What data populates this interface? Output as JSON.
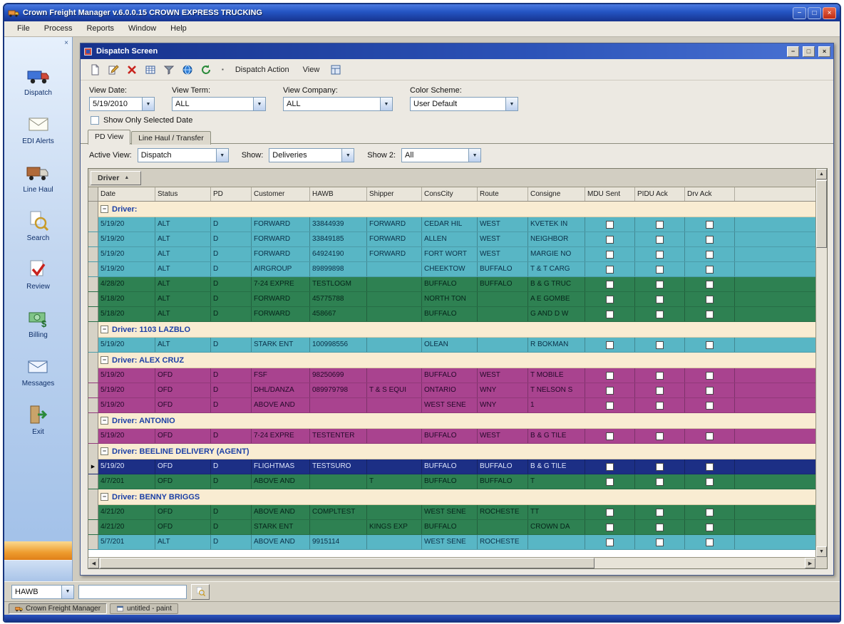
{
  "app": {
    "title": "Crown Freight Manager v.6.0.0.15 CROWN EXPRESS TRUCKING",
    "menu": [
      "File",
      "Process",
      "Reports",
      "Window",
      "Help"
    ]
  },
  "sidebar": {
    "items": [
      {
        "label": "Dispatch",
        "icon": "dispatch-truck-icon"
      },
      {
        "label": "EDI Alerts",
        "icon": "edi-alerts-mail-icon"
      },
      {
        "label": "Line Haul",
        "icon": "line-haul-truck-icon"
      },
      {
        "label": "Search",
        "icon": "search-icon"
      },
      {
        "label": "Review",
        "icon": "review-check-icon"
      },
      {
        "label": "Billing",
        "icon": "billing-money-icon"
      },
      {
        "label": "Messages",
        "icon": "messages-mail-icon"
      },
      {
        "label": "Exit",
        "icon": "exit-icon"
      }
    ]
  },
  "dispatch": {
    "title": "Dispatch Screen",
    "toolbar": {
      "icons": [
        "new-icon",
        "edit-icon",
        "delete-icon",
        "grid-icon",
        "filter-icon",
        "globe-icon",
        "refresh-icon"
      ],
      "dispatch_action": "Dispatch Action",
      "view": "View",
      "trailing_icon": "layout-icon"
    },
    "filters": {
      "view_date": {
        "label": "View Date:",
        "value": "5/19/2010"
      },
      "view_term": {
        "label": "View Term:",
        "value": "ALL"
      },
      "view_company": {
        "label": "View Company:",
        "value": "ALL"
      },
      "color_scheme": {
        "label": "Color Scheme:",
        "value": "User Default"
      },
      "show_only_selected_date": {
        "label": "Show Only Selected Date",
        "checked": false
      }
    },
    "tabs": [
      {
        "label": "PD View",
        "active": true
      },
      {
        "label": "Line Haul / Transfer",
        "active": false
      }
    ],
    "view_row": {
      "active_view": {
        "label": "Active View:",
        "value": "Dispatch"
      },
      "show": {
        "label": "Show:",
        "value": "Deliveries"
      },
      "show2": {
        "label": "Show 2:",
        "value": "All"
      }
    },
    "grid": {
      "group_by_button": "Driver",
      "columns": [
        "Date",
        "Status",
        "PD",
        "Customer",
        "HAWB",
        "Shipper",
        "ConsCity",
        "Route",
        "Consigne",
        "MDU Sent",
        "PIDU Ack",
        "Drv Ack"
      ],
      "groups": [
        {
          "label": "Driver:",
          "rows": [
            {
              "color": "teal",
              "selected": false,
              "cells": [
                "5/19/20",
                "ALT",
                "D",
                "FORWARD",
                "33844939",
                "FORWARD",
                "CEDAR HIL",
                "WEST",
                "KVETEK IN"
              ],
              "checks": [
                false,
                false,
                false
              ]
            },
            {
              "color": "teal",
              "selected": false,
              "cells": [
                "5/19/20",
                "ALT",
                "D",
                "FORWARD",
                "33849185",
                "FORWARD",
                "ALLEN",
                "WEST",
                "NEIGHBOR"
              ],
              "checks": [
                false,
                false,
                false
              ]
            },
            {
              "color": "teal",
              "selected": false,
              "cells": [
                "5/19/20",
                "ALT",
                "D",
                "FORWARD",
                "64924190",
                "FORWARD",
                "FORT WORT",
                "WEST",
                "MARGIE NO"
              ],
              "checks": [
                false,
                false,
                false
              ]
            },
            {
              "color": "teal",
              "selected": false,
              "cells": [
                "5/19/20",
                "ALT",
                "D",
                "AIRGROUP",
                "89899898",
                "",
                "CHEEKTOW",
                "BUFFALO",
                "T & T CARG"
              ],
              "checks": [
                false,
                false,
                false
              ]
            },
            {
              "color": "green",
              "selected": false,
              "cells": [
                "4/28/20",
                "ALT",
                "D",
                "7-24 EXPRE",
                "TESTLOGM",
                "",
                "BUFFALO",
                "BUFFALO",
                "B & G TRUC"
              ],
              "checks": [
                false,
                false,
                false
              ]
            },
            {
              "color": "green",
              "selected": false,
              "cells": [
                "5/18/20",
                "ALT",
                "D",
                "FORWARD",
                "45775788",
                "",
                "NORTH TON",
                "",
                "A E GOMBE"
              ],
              "checks": [
                false,
                false,
                false
              ]
            },
            {
              "color": "green",
              "selected": false,
              "cells": [
                "5/18/20",
                "ALT",
                "D",
                "FORWARD",
                "458667",
                "",
                "BUFFALO",
                "",
                "G AND D W"
              ],
              "checks": [
                false,
                false,
                false
              ]
            }
          ]
        },
        {
          "label": "Driver: 1103 LAZBLO",
          "rows": [
            {
              "color": "teal",
              "selected": false,
              "cells": [
                "5/19/20",
                "ALT",
                "D",
                "STARK ENT",
                "100998556",
                "",
                "OLEAN",
                "",
                "R BOKMAN"
              ],
              "checks": [
                false,
                false,
                false
              ]
            }
          ]
        },
        {
          "label": "Driver: ALEX CRUZ",
          "rows": [
            {
              "color": "purple",
              "selected": false,
              "cells": [
                "5/19/20",
                "OFD",
                "D",
                "FSF",
                "98250699",
                "",
                "BUFFALO",
                "WEST",
                "T MOBILE"
              ],
              "checks": [
                false,
                false,
                false
              ]
            },
            {
              "color": "purple",
              "selected": false,
              "cells": [
                "5/19/20",
                "OFD",
                "D",
                "DHL/DANZA",
                "089979798",
                "T & S EQUI",
                "ONTARIO",
                "WNY",
                "T NELSON S"
              ],
              "checks": [
                false,
                false,
                false
              ]
            },
            {
              "color": "purple",
              "selected": false,
              "cells": [
                "5/19/20",
                "OFD",
                "D",
                "ABOVE AND",
                "",
                "",
                "WEST SENE",
                "WNY",
                "1"
              ],
              "checks": [
                false,
                false,
                false
              ]
            }
          ]
        },
        {
          "label": "Driver: ANTONIO",
          "rows": [
            {
              "color": "purple",
              "selected": false,
              "cells": [
                "5/19/20",
                "OFD",
                "D",
                "7-24 EXPRE",
                "TESTENTER",
                "",
                "BUFFALO",
                "WEST",
                "B & G TILE"
              ],
              "checks": [
                false,
                false,
                false
              ]
            }
          ]
        },
        {
          "label": "Driver: BEELINE DELIVERY (AGENT)",
          "rows": [
            {
              "color": "navy",
              "selected": true,
              "cells": [
                "5/19/20",
                "OFD",
                "D",
                "FLIGHTMAS",
                "TESTSURO",
                "",
                "BUFFALO",
                "BUFFALO",
                "B & G TILE"
              ],
              "checks": [
                false,
                false,
                false
              ]
            },
            {
              "color": "green",
              "selected": false,
              "cells": [
                "4/7/201",
                "OFD",
                "D",
                "ABOVE AND",
                "",
                "T",
                "BUFFALO",
                "BUFFALO",
                "T"
              ],
              "checks": [
                false,
                false,
                false
              ]
            }
          ]
        },
        {
          "label": "Driver: BENNY BRIGGS",
          "rows": [
            {
              "color": "green",
              "selected": false,
              "cells": [
                "4/21/20",
                "OFD",
                "D",
                "ABOVE AND",
                "COMPLTEST",
                "",
                "WEST SENE",
                "ROCHESTE",
                "TT"
              ],
              "checks": [
                false,
                false,
                false
              ]
            },
            {
              "color": "green",
              "selected": false,
              "cells": [
                "4/21/20",
                "OFD",
                "D",
                "STARK ENT",
                "",
                "KINGS EXP",
                "BUFFALO",
                "",
                "CROWN DA"
              ],
              "checks": [
                false,
                false,
                false
              ]
            },
            {
              "color": "teal",
              "selected": false,
              "cells": [
                "5/7/201",
                "ALT",
                "D",
                "ABOVE AND",
                "9915114",
                "",
                "WEST SENE",
                "ROCHESTE",
                ""
              ],
              "checks": [
                false,
                false,
                false
              ]
            }
          ]
        }
      ]
    }
  },
  "bottom_bar": {
    "field_select_value": "HAWB",
    "search_value": "",
    "search_button_icon": "search-icon"
  },
  "taskbar": {
    "items": [
      {
        "icon": "app-icon",
        "label": "Crown Freight Manager",
        "active": true
      },
      {
        "icon": "window-icon",
        "label": "untitled - paint",
        "active": false
      }
    ]
  },
  "colors": {
    "row_teal": "#58b6c5",
    "row_green": "#2e8152",
    "row_purple": "#a9438f",
    "row_selected": "#1c2f85",
    "group_header_bg": "#f9ecd2",
    "group_header_text": "#1c40a6",
    "titlebar_blue": "#2454c2"
  },
  "icons_used": [
    "app-icon",
    "child-icon",
    "dispatch-truck-icon",
    "edi-alerts-mail-icon",
    "line-haul-truck-icon",
    "search-icon",
    "review-check-icon",
    "billing-money-icon",
    "messages-mail-icon",
    "exit-icon",
    "new-icon",
    "edit-icon",
    "delete-icon",
    "grid-icon",
    "filter-icon",
    "globe-icon",
    "refresh-icon",
    "layout-icon",
    "window-icon"
  ]
}
